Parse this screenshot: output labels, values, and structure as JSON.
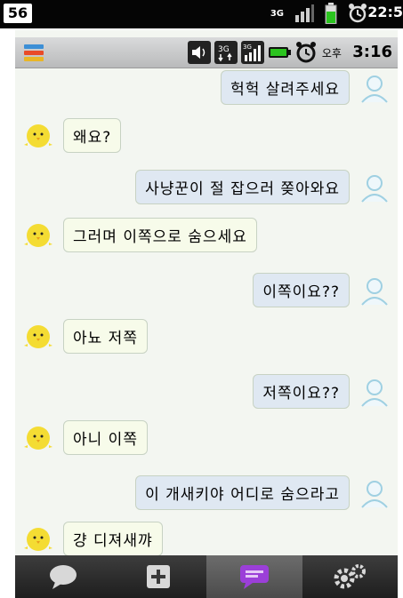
{
  "outer_status": {
    "badge": "56",
    "network": "3G",
    "time": "22:5"
  },
  "status": {
    "ampm": "오후",
    "time": "3:16",
    "network": "3G"
  },
  "messages": [
    {
      "side": "right",
      "text": "헉헉 살려주세요"
    },
    {
      "side": "left",
      "text": "왜요?"
    },
    {
      "side": "right",
      "text": "사냥꾼이 절 잡으러 쫒아와요"
    },
    {
      "side": "left",
      "text": "그러며 이쪽으로 숨으세요"
    },
    {
      "side": "right",
      "text": "이쪽이요??"
    },
    {
      "side": "left",
      "text": "아뇨 저쪽"
    },
    {
      "side": "right",
      "text": "저쪽이요??"
    },
    {
      "side": "left",
      "text": "아니 이쪽"
    },
    {
      "side": "right",
      "text": "이 개새키야 어디로 숨으라고"
    },
    {
      "side": "left",
      "text": "걍 디져새꺄"
    }
  ],
  "tabs": [
    {
      "icon": "speech-bubble-icon"
    },
    {
      "icon": "add-icon"
    },
    {
      "icon": "chat-icon",
      "active": true
    },
    {
      "icon": "gear-icon"
    }
  ],
  "colors": {
    "chat_background": "#f3f6f1",
    "right_bubble": "#dfe8f2",
    "left_bubble": "#f7fbea",
    "active_tab_icon": "#9b3fd8"
  }
}
